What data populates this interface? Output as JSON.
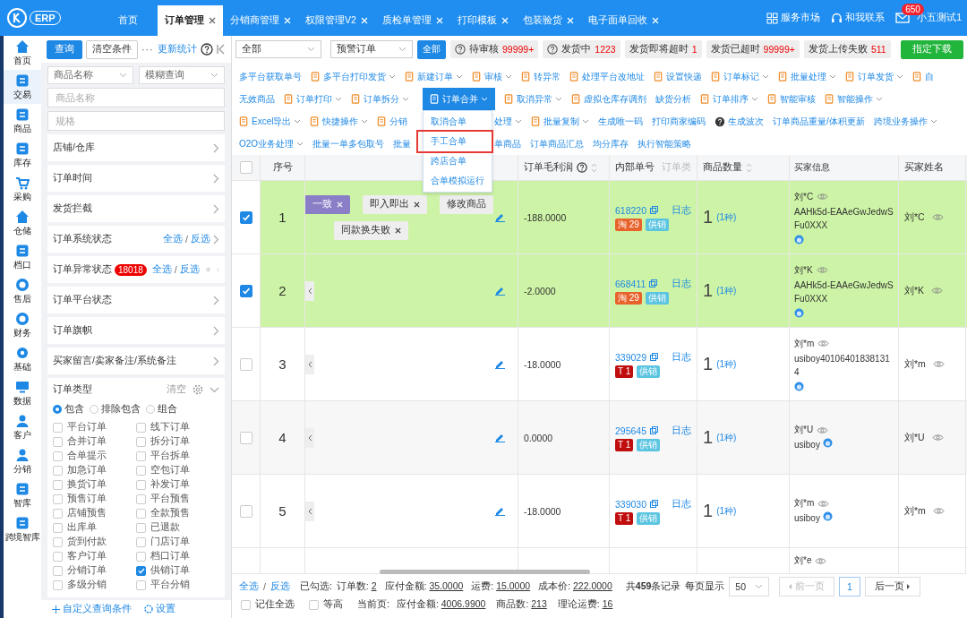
{
  "topbar": {
    "logo": "ERP",
    "tabs": [
      {
        "label": "首页",
        "selected": false,
        "closable": false
      },
      {
        "label": "订单管理",
        "selected": true,
        "closable": true
      },
      {
        "label": "分销商管理",
        "selected": false,
        "closable": true
      },
      {
        "label": "权限管理V2",
        "selected": false,
        "closable": true
      },
      {
        "label": "质检单管理",
        "selected": false,
        "closable": true
      },
      {
        "label": "打印模板",
        "selected": false,
        "closable": true
      },
      {
        "label": "包装验货",
        "selected": false,
        "closable": true
      },
      {
        "label": "电子面单回收",
        "selected": false,
        "closable": true
      }
    ],
    "links": [
      "服务市场",
      "和我联系"
    ],
    "mail_badge": "650",
    "user": "小五测试1"
  },
  "nav": [
    {
      "label": "首页",
      "selected": false
    },
    {
      "label": "交易",
      "selected": true
    },
    {
      "label": "商品",
      "selected": false
    },
    {
      "label": "库存",
      "selected": false
    },
    {
      "label": "采购",
      "selected": false
    },
    {
      "label": "仓储",
      "selected": false
    },
    {
      "label": "档口",
      "selected": false
    },
    {
      "label": "售后",
      "selected": false
    },
    {
      "label": "财务",
      "selected": false
    },
    {
      "label": "基础",
      "selected": false
    },
    {
      "label": "数据",
      "selected": false
    },
    {
      "label": "客户",
      "selected": false
    },
    {
      "label": "分销",
      "selected": false
    },
    {
      "label": "智库",
      "selected": false
    },
    {
      "label": "跨境智库",
      "selected": false
    }
  ],
  "filter_panel": {
    "query_button": "查询",
    "clear_button": "清空条件",
    "more": "···",
    "update_link": "更新统计",
    "selects": [
      "商品名称",
      "模糊查询"
    ],
    "inputs": [
      {
        "placeholder": "商品名称"
      },
      {
        "placeholder": "规格"
      }
    ],
    "sections": [
      {
        "label": "店铺/仓库"
      },
      {
        "label": "订单时间"
      },
      {
        "label": "发货拦截"
      },
      {
        "label": "订单系统状态",
        "select_all": "全选",
        "separator": "/",
        "invert": "反选"
      },
      {
        "label": "订单异常状态",
        "badge": "18018",
        "select_all": "全选",
        "separator": "/",
        "invert": "反选",
        "settings": true
      },
      {
        "label": "订单平台状态"
      },
      {
        "label": "订单旗帜"
      },
      {
        "label": "买家留言/卖家备注/系统备注"
      }
    ],
    "order_type": {
      "title": "订单类型",
      "clear": "清空",
      "radios": [
        {
          "label": "包含",
          "selected": true
        },
        {
          "label": "排除包含",
          "selected": false
        },
        {
          "label": "组合",
          "selected": false
        }
      ],
      "options": [
        {
          "label": "平台订单",
          "checked": false
        },
        {
          "label": "线下订单",
          "checked": false
        },
        {
          "label": "合并订单",
          "checked": false
        },
        {
          "label": "拆分订单",
          "checked": false
        },
        {
          "label": "合单提示",
          "checked": false
        },
        {
          "label": "平台拆单",
          "checked": false
        },
        {
          "label": "加急订单",
          "checked": false
        },
        {
          "label": "空包订单",
          "checked": false
        },
        {
          "label": "换货订单",
          "checked": false
        },
        {
          "label": "补发订单",
          "checked": false
        },
        {
          "label": "预售订单",
          "checked": false
        },
        {
          "label": "平台预售",
          "checked": false
        },
        {
          "label": "店铺预售",
          "checked": false
        },
        {
          "label": "全款预售",
          "checked": false
        },
        {
          "label": "出库单",
          "checked": false
        },
        {
          "label": "已退款",
          "checked": false
        },
        {
          "label": "货到付款",
          "checked": false
        },
        {
          "label": "门店订单",
          "checked": false
        },
        {
          "label": "客户订单",
          "checked": false
        },
        {
          "label": "档口订单",
          "checked": false
        },
        {
          "label": "分销订单",
          "checked": false
        },
        {
          "label": "供销订单",
          "checked": true
        },
        {
          "label": "多级分销",
          "checked": false
        },
        {
          "label": "平台分销",
          "checked": false
        }
      ]
    },
    "footer_links": [
      "自定义查询条件",
      "设置"
    ]
  },
  "filter_bar": {
    "selects": [
      "全部",
      "预警订单"
    ],
    "all_button": "全部",
    "chips": [
      {
        "label": "待审核",
        "count": "99999+",
        "help": true
      },
      {
        "label": "发货中",
        "count": "1223",
        "help": true
      },
      {
        "label": "发货即将超时",
        "count": "1",
        "help": false
      },
      {
        "label": "发货已超时",
        "count": "99999+",
        "help": false
      },
      {
        "label": "发货上传失败",
        "count": "511",
        "help": false
      }
    ],
    "download_button": "指定下载"
  },
  "toolbar": [
    {
      "items": [
        {
          "label": "多平台获取单号",
          "icon": false,
          "caret": false
        },
        {
          "label": "多平台打印发货",
          "icon": true,
          "caret": true
        },
        {
          "label": "新建订单",
          "icon": true,
          "caret": true
        },
        {
          "label": "审核",
          "icon": true,
          "caret": true
        },
        {
          "label": "转异常",
          "icon": true,
          "caret": false
        },
        {
          "label": "处理平台改地址",
          "icon": true,
          "caret": false
        },
        {
          "label": "设置快递",
          "icon": true,
          "caret": false
        },
        {
          "label": "订单标记",
          "icon": true,
          "caret": true
        },
        {
          "label": "批量处理",
          "icon": true,
          "caret": true
        },
        {
          "label": "订单发货",
          "icon": true,
          "caret": true
        },
        {
          "label": "自",
          "icon": true,
          "caret": false
        }
      ]
    },
    {
      "items": [
        {
          "label": "无效商品",
          "icon": false,
          "caret": false
        },
        {
          "label": "订单打印",
          "icon": true,
          "caret": true
        },
        {
          "label": "订单拆分",
          "icon": true,
          "caret": true
        },
        {
          "label": "订单合并",
          "icon": true,
          "caret": true,
          "open": true,
          "menu": [
            {
              "label": "取消合单",
              "marked": false
            },
            {
              "label": "手工合单",
              "marked": true
            },
            {
              "label": "跨店合单",
              "marked": false
            },
            {
              "label": "合单模拟运行",
              "marked": false
            }
          ]
        },
        {
          "label": "取消异常",
          "icon": true,
          "caret": true
        },
        {
          "label": "虚拟仓库存调剂",
          "icon": true,
          "caret": false
        },
        {
          "label": "缺货分析",
          "icon": false,
          "caret": false
        },
        {
          "label": "订单排序",
          "icon": true,
          "caret": true
        },
        {
          "label": "智能审核",
          "icon": true,
          "caret": false
        },
        {
          "label": "智能操作",
          "icon": true,
          "caret": true
        }
      ]
    },
    {
      "items": [
        {
          "label": "Excel导出",
          "icon": true,
          "caret": true
        },
        {
          "label": "快捷操作",
          "icon": true,
          "caret": true
        },
        {
          "label": "分销",
          "icon": true,
          "caret": false
        }
      ],
      "after_menu": [
        {
          "label": "处理",
          "icon": false,
          "caret": true
        },
        {
          "label": "批量复制",
          "icon": true,
          "caret": true
        },
        {
          "label": "生成唯一码",
          "icon": false,
          "caret": false
        },
        {
          "label": "打印商家编码",
          "icon": false,
          "caret": false
        },
        {
          "label": "生成波次",
          "icon": false,
          "caret": false,
          "help": true
        },
        {
          "label": "订单商品重量/体积更新",
          "icon": false,
          "caret": false
        },
        {
          "label": "跨境业务操作",
          "icon": false,
          "caret": true
        }
      ]
    },
    {
      "items": [
        {
          "label": "O2O业务处理",
          "icon": false,
          "caret": true
        },
        {
          "label": "批量一单多包取号",
          "icon": false,
          "caret": false
        },
        {
          "label": "批量",
          "icon": false,
          "caret": false
        }
      ],
      "after_menu": [
        {
          "label": "单商品",
          "icon": false,
          "caret": false
        },
        {
          "label": "订单商品汇总",
          "icon": false,
          "caret": false
        },
        {
          "label": "均分库存",
          "icon": false,
          "caret": false
        },
        {
          "label": "执行智能策略",
          "icon": false,
          "caret": false
        }
      ]
    }
  ],
  "table": {
    "all_selected": false,
    "header": {
      "index": "序号",
      "profit": "订单毛利润",
      "order_no": "内部单号",
      "order_type": "订单类",
      "quantity": "商品数量",
      "buyer_info": "买家信息",
      "buyer_name": "买家姓名"
    },
    "rows": [
      {
        "kind": "order",
        "selected": true,
        "index": "1",
        "collapse": false,
        "tag_lines": [
          [
            {
              "text": "一致",
              "kind": "purple",
              "closable": true
            },
            {
              "text": "即入即出",
              "kind": "grey",
              "closable": true
            },
            {
              "text": "修改商品",
              "kind": "grey",
              "closable": false
            }
          ],
          [
            {
              "text": "同款换失败",
              "kind": "grey",
              "closable": true
            }
          ]
        ],
        "profit": "-188.0000",
        "order_no": "618220",
        "log": "日志",
        "platform": {
          "label": "淘",
          "count": "29",
          "color": "#e8622c"
        },
        "supply": "供销",
        "quantity": "1",
        "kinds": "(1种)",
        "buyer_nick": "刘*C",
        "buyer_id": "AAHk5d-EAAeGwJedwSFu0XXX",
        "buyer_name": "刘*C"
      },
      {
        "kind": "order",
        "selected": true,
        "index": "2",
        "collapse": true,
        "profit": "-2.0000",
        "order_no": "668411",
        "log": "日志",
        "platform": {
          "label": "淘",
          "count": "29",
          "color": "#e8622c"
        },
        "supply": "供销",
        "quantity": "1",
        "kinds": "(1种)",
        "buyer_nick": "刘*K",
        "buyer_id": "AAHk5d-EAAeGwJedwSFu0XXX",
        "buyer_name": "刘*K"
      },
      {
        "kind": "order",
        "selected": false,
        "index": "3",
        "collapse": true,
        "profit": "-18.0000",
        "order_no": "339029",
        "log": "日志",
        "platform": {
          "label": "T",
          "count": "1",
          "color": "#c00d0d"
        },
        "supply": "供销",
        "quantity": "1",
        "kinds": "(1种)",
        "buyer_nick": "刘*m",
        "buyer_id": "usiboy401064018381314",
        "buyer_name": "刘*m"
      },
      {
        "kind": "order",
        "selected": false,
        "index": "4",
        "collapse": true,
        "profit": "0.0000",
        "order_no": "295645",
        "log": "日志",
        "platform": {
          "label": "T",
          "count": "1",
          "color": "#c00d0d"
        },
        "supply": "供销",
        "quantity": "1",
        "kinds": "(1种)",
        "buyer_nick": "刘*U",
        "buyer_id": "usiboy",
        "buyer_name": "刘*U"
      },
      {
        "kind": "order",
        "selected": false,
        "index": "5",
        "collapse": true,
        "profit": "-18.0000",
        "order_no": "339030",
        "log": "日志",
        "platform": {
          "label": "T",
          "count": "1",
          "color": "#c00d0d"
        },
        "supply": "供销",
        "quantity": "1",
        "kinds": "(1种)",
        "buyer_nick": "刘*m",
        "buyer_id": "usiboy",
        "buyer_name": "刘*m"
      },
      {
        "kind": "partial",
        "buyer_nick": "刘*e"
      }
    ]
  },
  "footer": {
    "select_all": "全选",
    "separator": "/",
    "invert": "反选",
    "checked_label": "已勾选:",
    "stats": [
      {
        "label": "订单数:",
        "value": "2"
      },
      {
        "label": "应付金额:",
        "value": "35.0000"
      },
      {
        "label": "运费:",
        "value": "15.0000"
      },
      {
        "label": "成本价:",
        "value": "222.0000"
      }
    ],
    "total_prefix": "共",
    "total_count": "459",
    "total_suffix": "条记录",
    "page_size_label": "每页显示",
    "page_size": "50",
    "prev": "前一页",
    "page": "1",
    "next": "后一页",
    "remember": {
      "label": "记住全选",
      "checked": false
    },
    "equal_height": {
      "label": "等高",
      "checked": false
    },
    "page_stats_label": "当前页:",
    "page_stats": [
      {
        "label": "应付金额:",
        "value": "4006.9900"
      },
      {
        "label": "商品数:",
        "value": "213"
      },
      {
        "label": "理论运费:",
        "value": "16"
      }
    ]
  }
}
